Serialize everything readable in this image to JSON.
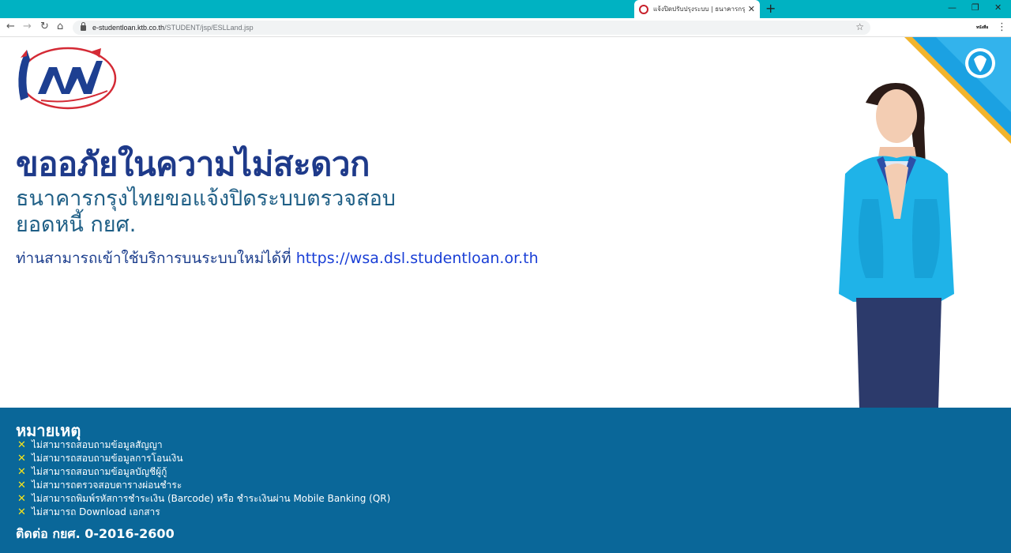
{
  "browser": {
    "tab_title": "แจ้งปิดปรับปรุงระบบ | ธนาคารกรุงไทย",
    "url_host": "e-studentloan.ktb.co.th",
    "url_path": "/STUDENT/jsp/ESLLand.jsp",
    "profile_label": "หนังสือ"
  },
  "page": {
    "headline": "ขออภัยในความไม่สะดวก",
    "sub_line1": "ธนาคารกรุงไทยขอแจ้งปิดระบบตรวจสอบ",
    "sub_line2": "ยอดหนี้ กยศ.",
    "notice_text": "ท่านสามารถเข้าใช้บริการบนระบบใหม่ได้ที่ ",
    "notice_link": "https://wsa.dsl.studentloan.or.th"
  },
  "footer": {
    "title": "หมายเหตุ",
    "notes": [
      "ไม่สามารถสอบถามข้อมูลสัญญา",
      "ไม่สามารถสอบถามข้อมูลการโอนเงิน",
      "ไม่สามารถสอบถามข้อมูลบัญชีผู้กู้",
      "ไม่สามารถตรวจสอบตารางผ่อนชำระ",
      "ไม่สามารถพิมพ์รหัสการชำระเงิน (Barcode) หรือ ชำระเงินผ่าน Mobile Banking (QR)",
      "ไม่สามารถ Download เอกสาร"
    ],
    "contact": "ติดต่อ กยศ. 0-2016-2600"
  },
  "colors": {
    "tabbar": "#00b2c2",
    "footer_bg": "#0a6799",
    "headline": "#1e3a8a",
    "note_mark": "#f5e31d"
  },
  "icons": [
    "back-arrow-icon",
    "forward-arrow-icon",
    "reload-icon",
    "home-icon",
    "lock-icon",
    "star-icon",
    "close-icon",
    "plus-icon",
    "kebab-menu-icon"
  ]
}
